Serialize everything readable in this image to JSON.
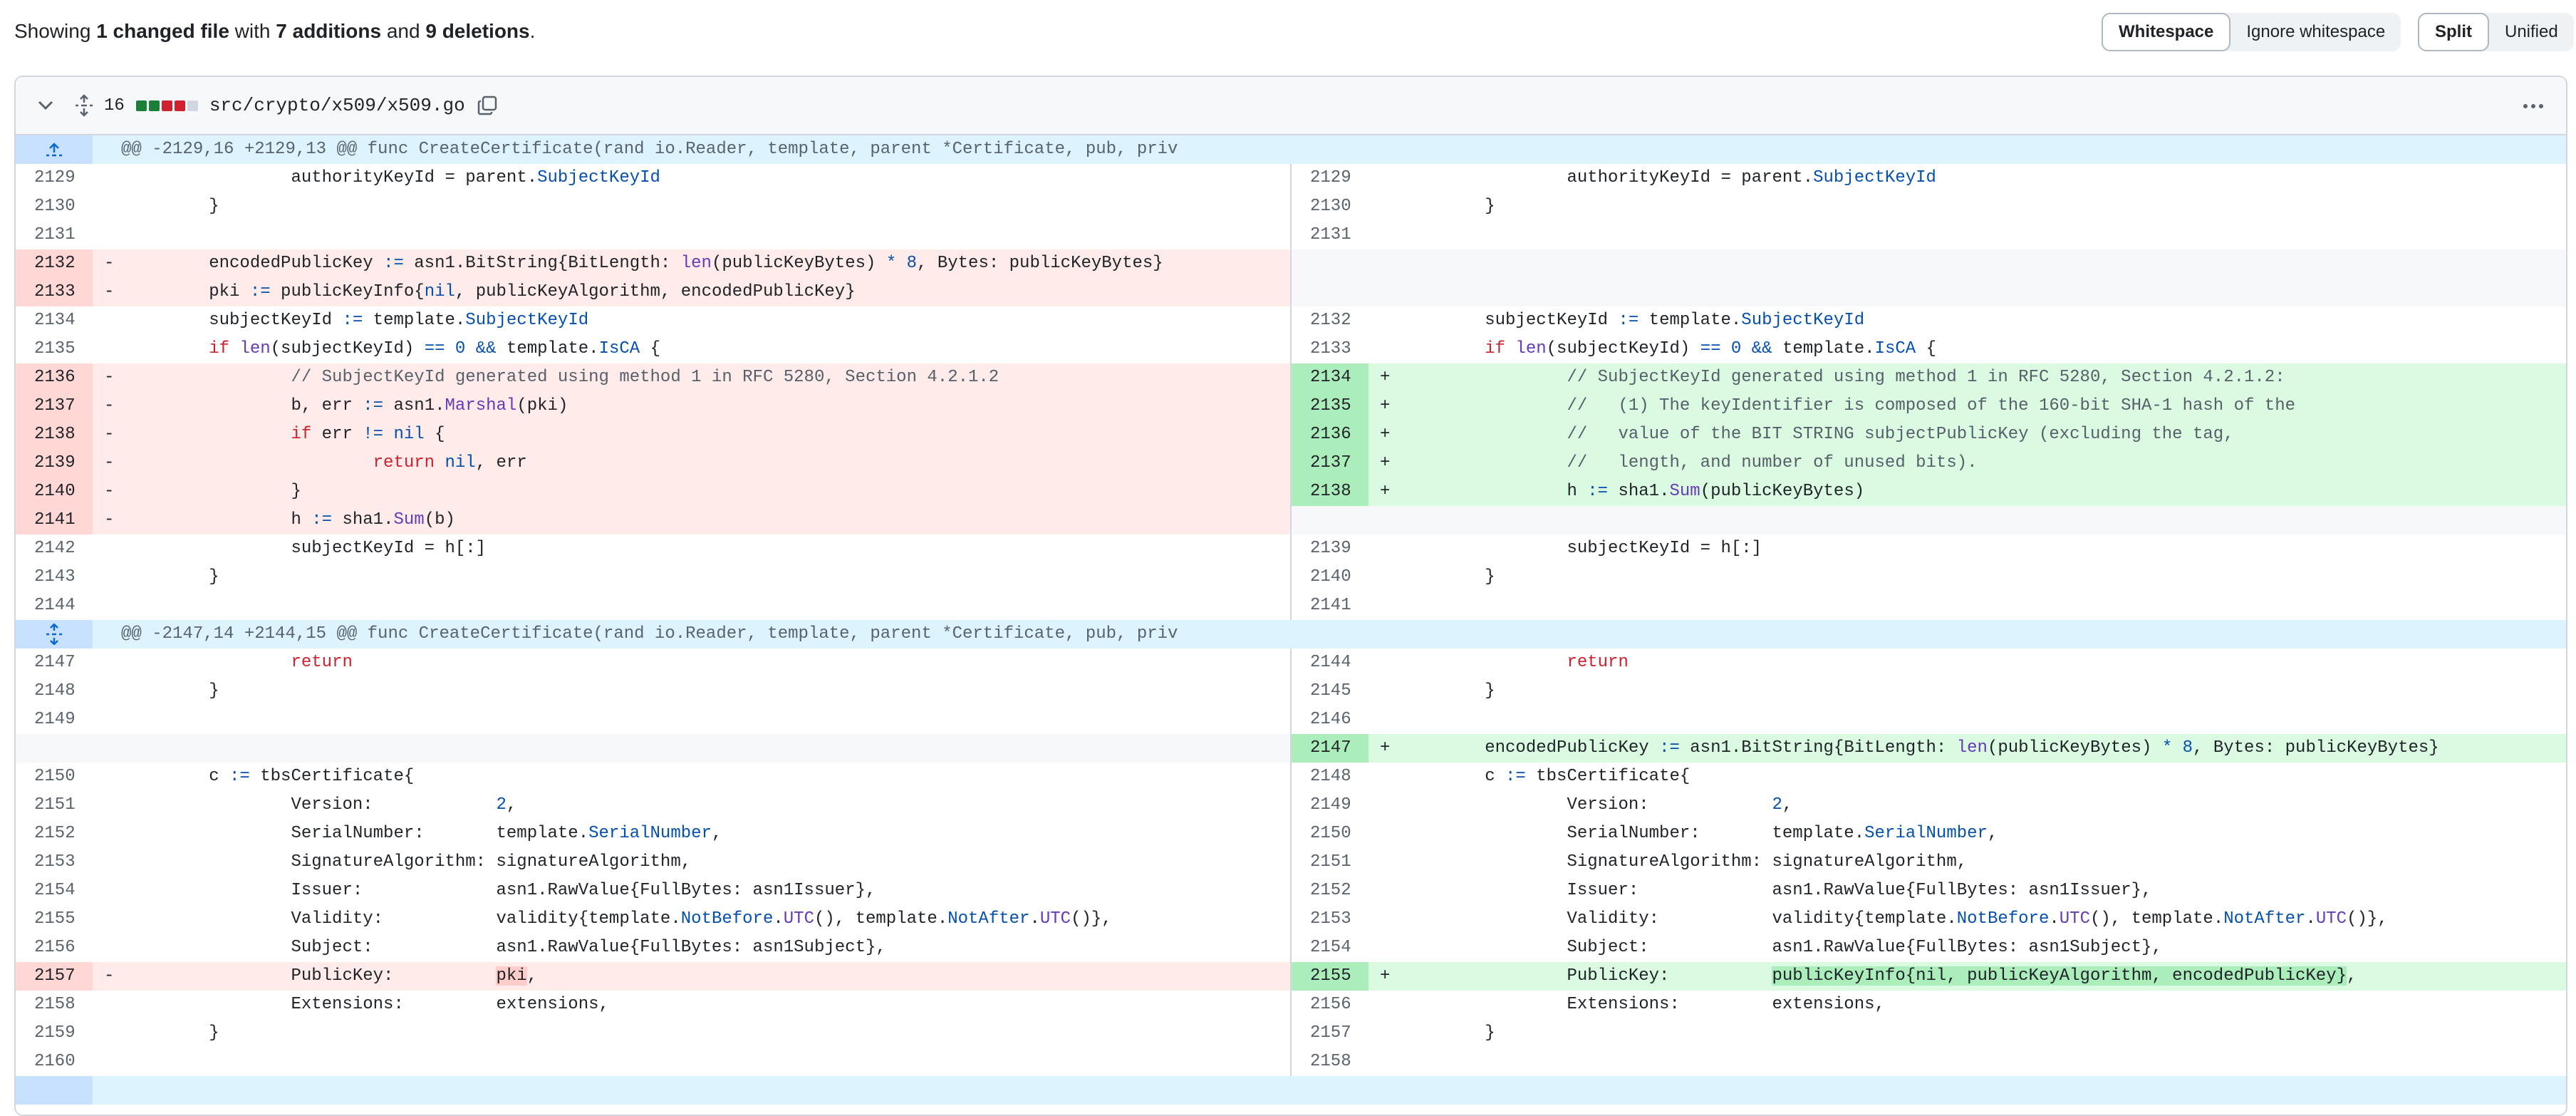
{
  "summary": {
    "prefix": "Showing ",
    "files": "1 changed file",
    "mid1": " with ",
    "additions": "7 additions",
    "mid2": " and ",
    "deletions": "9 deletions",
    "end": "."
  },
  "whitespace_toggle": {
    "whitespace": "Whitespace",
    "ignore": "Ignore whitespace"
  },
  "view_toggle": {
    "split": "Split",
    "unified": "Unified"
  },
  "file": {
    "changes": "16",
    "name": "src/crypto/x509/x509.go",
    "diffstat_colors": [
      "#1a7f37",
      "#1a7f37",
      "#cf222e",
      "#cf222e",
      "#d0d7de"
    ]
  },
  "hunks": [
    "@@ -2129,16 +2129,13 @@ func CreateCertificate(rand io.Reader, template, parent *Certificate, pub, priv",
    "@@ -2147,14 +2144,15 @@ func CreateCertificate(rand io.Reader, template, parent *Certificate, pub, priv"
  ],
  "colors": {
    "deletion_bg": "#ffebe9",
    "addition_bg": "#dafbe1",
    "hunk_bg": "#ddf4ff"
  }
}
